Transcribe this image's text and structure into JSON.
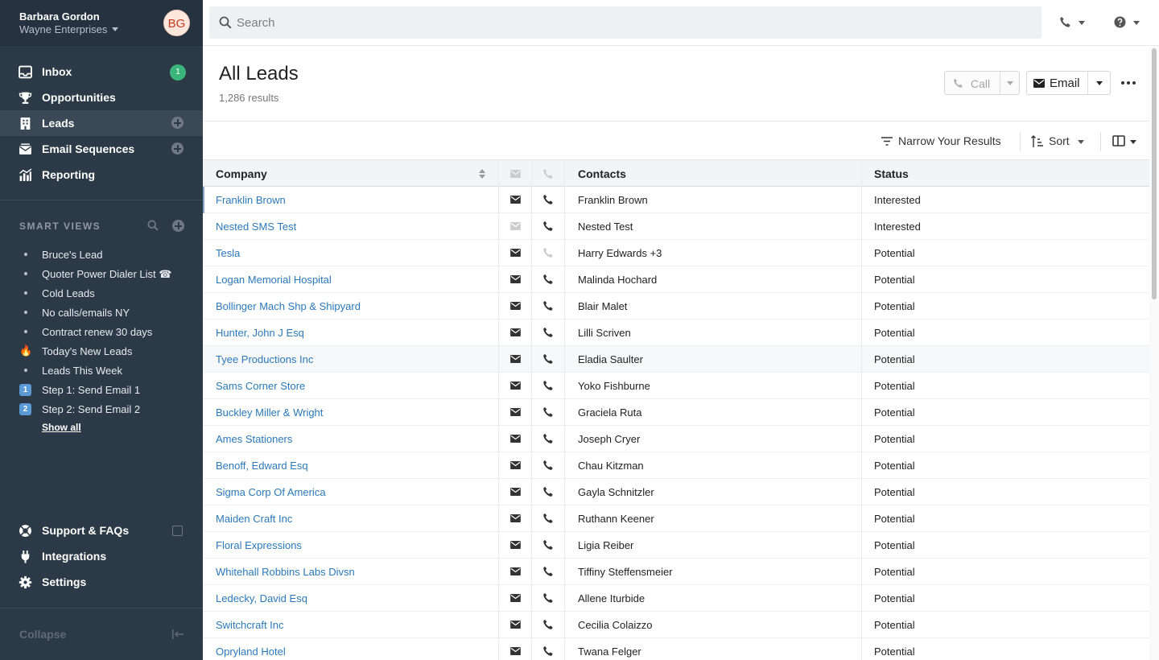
{
  "user": {
    "name": "Barbara Gordon",
    "org": "Wayne Enterprises",
    "initials": "BG"
  },
  "nav": {
    "items": [
      {
        "label": "Inbox",
        "icon": "inbox-icon",
        "badge": "1"
      },
      {
        "label": "Opportunities",
        "icon": "trophy-icon"
      },
      {
        "label": "Leads",
        "icon": "building-icon",
        "active": true
      },
      {
        "label": "Email Sequences",
        "icon": "envelope-stack-icon"
      },
      {
        "label": "Reporting",
        "icon": "chart-icon"
      }
    ]
  },
  "smart_views": {
    "title": "SMART VIEWS",
    "items": [
      {
        "label": "Bruce's Lead",
        "marker": "bullet"
      },
      {
        "label": "Quoter Power Dialer List ☎",
        "marker": "bullet"
      },
      {
        "label": "Cold Leads",
        "marker": "bullet"
      },
      {
        "label": "No calls/emails NY",
        "marker": "bullet"
      },
      {
        "label": "Contract renew 30 days",
        "marker": "bullet"
      },
      {
        "label": "Today's New Leads",
        "marker": "🔥"
      },
      {
        "label": "Leads This Week",
        "marker": "bullet"
      },
      {
        "label": "Step 1: Send Email 1",
        "marker": "1"
      },
      {
        "label": "Step 2: Send Email 2",
        "marker": "2"
      }
    ],
    "show_all": "Show all"
  },
  "footer_nav": {
    "support": "Support & FAQs",
    "integrations": "Integrations",
    "settings": "Settings",
    "collapse": "Collapse"
  },
  "search": {
    "placeholder": "Search"
  },
  "header": {
    "title": "All Leads",
    "count": "1,286 results",
    "call_label": "Call",
    "email_label": "Email"
  },
  "toolbar": {
    "narrow": "Narrow Your Results",
    "sort": "Sort"
  },
  "table": {
    "columns": {
      "company": "Company",
      "contacts": "Contacts",
      "status": "Status"
    },
    "rows": [
      {
        "company": "Franklin Brown",
        "contacts": "Franklin Brown",
        "status": "Interested",
        "mail": true,
        "phone": true
      },
      {
        "company": "Nested SMS Test",
        "contacts": "Nested Test",
        "status": "Interested",
        "mail": false,
        "phone": true
      },
      {
        "company": "Tesla",
        "contacts": "Harry Edwards +3",
        "status": "Potential",
        "mail": true,
        "phone": false
      },
      {
        "company": "Logan Memorial Hospital",
        "contacts": "Malinda Hochard",
        "status": "Potential",
        "mail": true,
        "phone": true
      },
      {
        "company": "Bollinger Mach Shp & Shipyard",
        "contacts": "Blair Malet",
        "status": "Potential",
        "mail": true,
        "phone": true
      },
      {
        "company": "Hunter, John J Esq",
        "contacts": "Lilli Scriven",
        "status": "Potential",
        "mail": true,
        "phone": true
      },
      {
        "company": "Tyee Productions Inc",
        "contacts": "Eladia Saulter",
        "status": "Potential",
        "mail": true,
        "phone": true
      },
      {
        "company": "Sams Corner Store",
        "contacts": "Yoko Fishburne",
        "status": "Potential",
        "mail": true,
        "phone": true
      },
      {
        "company": "Buckley Miller & Wright",
        "contacts": "Graciela Ruta",
        "status": "Potential",
        "mail": true,
        "phone": true
      },
      {
        "company": "Ames Stationers",
        "contacts": "Joseph Cryer",
        "status": "Potential",
        "mail": true,
        "phone": true
      },
      {
        "company": "Benoff, Edward Esq",
        "contacts": "Chau Kitzman",
        "status": "Potential",
        "mail": true,
        "phone": true
      },
      {
        "company": "Sigma Corp Of America",
        "contacts": "Gayla Schnitzler",
        "status": "Potential",
        "mail": true,
        "phone": true
      },
      {
        "company": "Maiden Craft Inc",
        "contacts": "Ruthann Keener",
        "status": "Potential",
        "mail": true,
        "phone": true
      },
      {
        "company": "Floral Expressions",
        "contacts": "Ligia Reiber",
        "status": "Potential",
        "mail": true,
        "phone": true
      },
      {
        "company": "Whitehall Robbins Labs Divsn",
        "contacts": "Tiffiny Steffensmeier",
        "status": "Potential",
        "mail": true,
        "phone": true
      },
      {
        "company": "Ledecky, David Esq",
        "contacts": "Allene Iturbide",
        "status": "Potential",
        "mail": true,
        "phone": true
      },
      {
        "company": "Switchcraft Inc",
        "contacts": "Cecilia Colaizzo",
        "status": "Potential",
        "mail": true,
        "phone": true
      },
      {
        "company": "Opryland Hotel",
        "contacts": "Twana Felger",
        "status": "Potential",
        "mail": true,
        "phone": true
      }
    ]
  },
  "colors": {
    "sidebar": "#2c3a47",
    "link": "#2b79b9",
    "badge": "#3ab67a"
  }
}
